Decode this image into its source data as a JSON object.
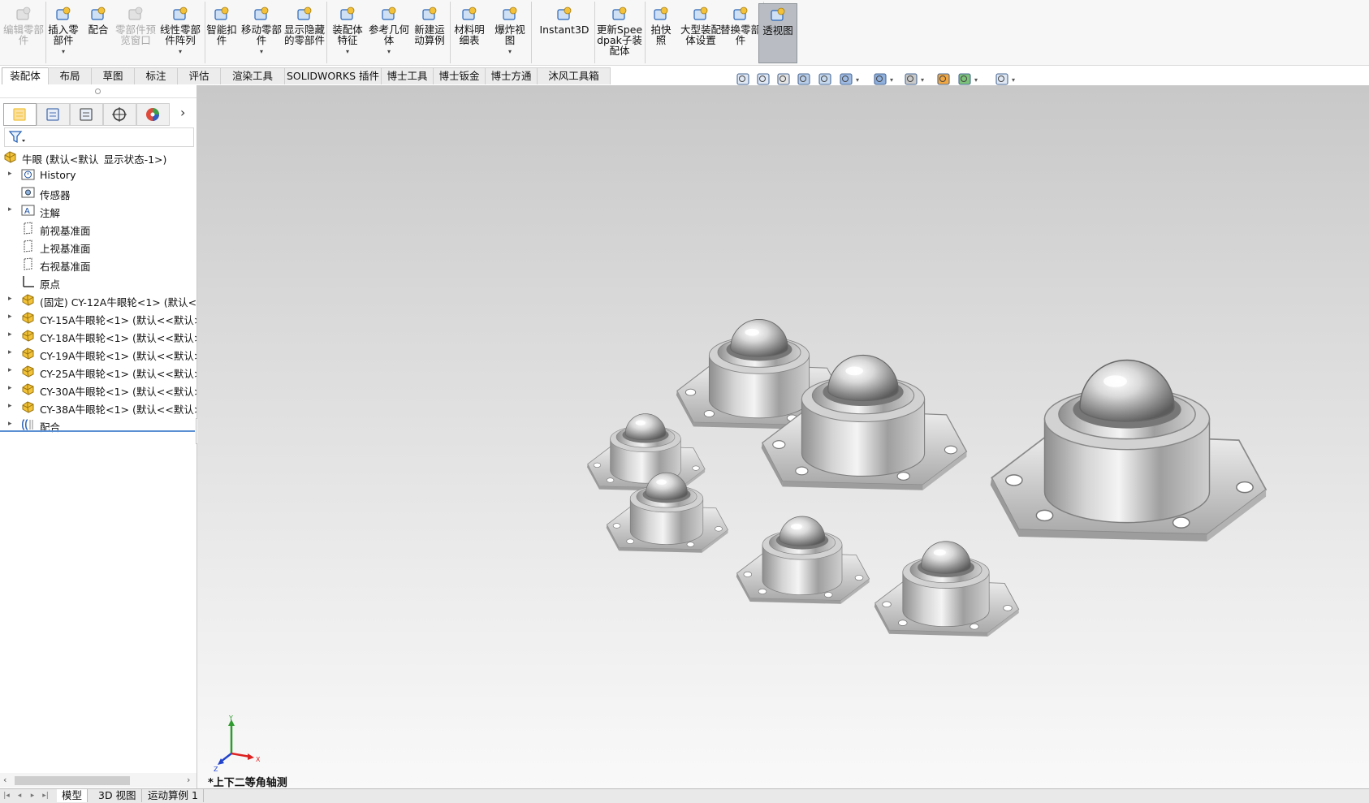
{
  "ribbon": {
    "buttons": [
      {
        "label": "编辑零部件",
        "disabled": true,
        "icon": "edit-component-icon"
      },
      {
        "label": "插入零部件",
        "disabled": false,
        "icon": "insert-component-icon",
        "dropdown": true
      },
      {
        "label": "配合",
        "disabled": false,
        "icon": "mate-icon"
      },
      {
        "label": "零部件预览窗口",
        "disabled": true,
        "icon": "component-preview-icon"
      },
      {
        "label": "线性零部件阵列",
        "disabled": false,
        "icon": "linear-pattern-icon",
        "dropdown": true
      },
      {
        "label": "智能扣件",
        "disabled": false,
        "icon": "smart-fastener-icon"
      },
      {
        "label": "移动零部件",
        "disabled": false,
        "icon": "move-component-icon",
        "dropdown": true
      },
      {
        "label": "显示隐藏的零部件",
        "disabled": false,
        "icon": "show-hidden-icon"
      },
      {
        "label": "装配体特征",
        "disabled": false,
        "icon": "assembly-feature-icon",
        "dropdown": true
      },
      {
        "label": "参考几何体",
        "disabled": false,
        "icon": "reference-geometry-icon",
        "dropdown": true
      },
      {
        "label": "新建运动算例",
        "disabled": false,
        "icon": "motion-study-icon"
      },
      {
        "label": "材料明细表",
        "disabled": false,
        "icon": "bom-icon"
      },
      {
        "label": "爆炸视图",
        "disabled": false,
        "icon": "exploded-view-icon",
        "dropdown": true
      },
      {
        "label": "Instant3D",
        "disabled": false,
        "icon": "instant3d-icon"
      },
      {
        "label": "更新Speedpak子装配体",
        "disabled": false,
        "icon": "speedpak-icon"
      },
      {
        "label": "拍快照",
        "disabled": false,
        "icon": "snapshot-icon"
      },
      {
        "label": "大型装配体设置",
        "disabled": false,
        "icon": "large-assembly-icon"
      },
      {
        "label": "替换零部件",
        "disabled": false,
        "icon": "replace-component-icon"
      },
      {
        "label": "透视图",
        "disabled": false,
        "icon": "perspective-icon",
        "active": true
      }
    ]
  },
  "command_tabs": [
    "装配体",
    "布局",
    "草图",
    "标注",
    "评估",
    "渲染工具",
    "SOLIDWORKS 插件",
    "博士工具",
    "博士钣金",
    "博士方通",
    "沐风工具箱"
  ],
  "selected_tab": "装配体",
  "left_panel": {
    "tabs": [
      "featuremanager-icon",
      "propertymanager-icon",
      "configurationmanager-icon",
      "dimxpert-icon",
      "displaymanager-icon"
    ],
    "tree": [
      {
        "text": "牛眼  (默认<默认_显示状态-1>)",
        "icon": "assembly-icon",
        "expand": false,
        "level": 0
      },
      {
        "text": "History",
        "icon": "history-icon",
        "expand": true,
        "level": 1
      },
      {
        "text": "传感器",
        "icon": "sensor-icon",
        "expand": false,
        "level": 1
      },
      {
        "text": "注解",
        "icon": "annotation-icon",
        "expand": true,
        "level": 1
      },
      {
        "text": "前视基准面",
        "icon": "plane-icon",
        "expand": false,
        "level": 1
      },
      {
        "text": "上视基准面",
        "icon": "plane-icon",
        "expand": false,
        "level": 1
      },
      {
        "text": "右视基准面",
        "icon": "plane-icon",
        "expand": false,
        "level": 1
      },
      {
        "text": "原点",
        "icon": "origin-icon",
        "expand": false,
        "level": 1
      },
      {
        "text": "(固定) CY-12A牛眼轮<1> (默认<<",
        "icon": "subassembly-icon",
        "expand": true,
        "level": 1
      },
      {
        "text": "CY-15A牛眼轮<1> (默认<<默认>_",
        "icon": "subassembly-icon",
        "expand": true,
        "level": 1
      },
      {
        "text": "CY-18A牛眼轮<1> (默认<<默认>_",
        "icon": "subassembly-icon",
        "expand": true,
        "level": 1
      },
      {
        "text": "CY-19A牛眼轮<1> (默认<<默认>_",
        "icon": "subassembly-icon",
        "expand": true,
        "level": 1
      },
      {
        "text": "CY-25A牛眼轮<1> (默认<<默认>_",
        "icon": "subassembly-icon",
        "expand": true,
        "level": 1
      },
      {
        "text": "CY-30A牛眼轮<1> (默认<<默认>_",
        "icon": "subassembly-icon",
        "expand": true,
        "level": 1
      },
      {
        "text": "CY-38A牛眼轮<1> (默认<<默认>_",
        "icon": "subassembly-icon",
        "expand": true,
        "level": 1
      },
      {
        "text": "配合",
        "icon": "mates-folder-icon",
        "expand": true,
        "level": 1
      }
    ]
  },
  "viewport": {
    "view_name": "*上下二等角轴测",
    "triad_labels": {
      "x": "X",
      "y": "Y",
      "z": "Z"
    },
    "colors": {
      "background_top": "#c8c8c8",
      "background_bottom": "#f9f9f9",
      "part_metal": "#b8b8b8"
    }
  },
  "bottom_tabs": [
    "模型",
    "3D 视图",
    "运动算例 1"
  ],
  "selected_bottom_tab": "模型"
}
